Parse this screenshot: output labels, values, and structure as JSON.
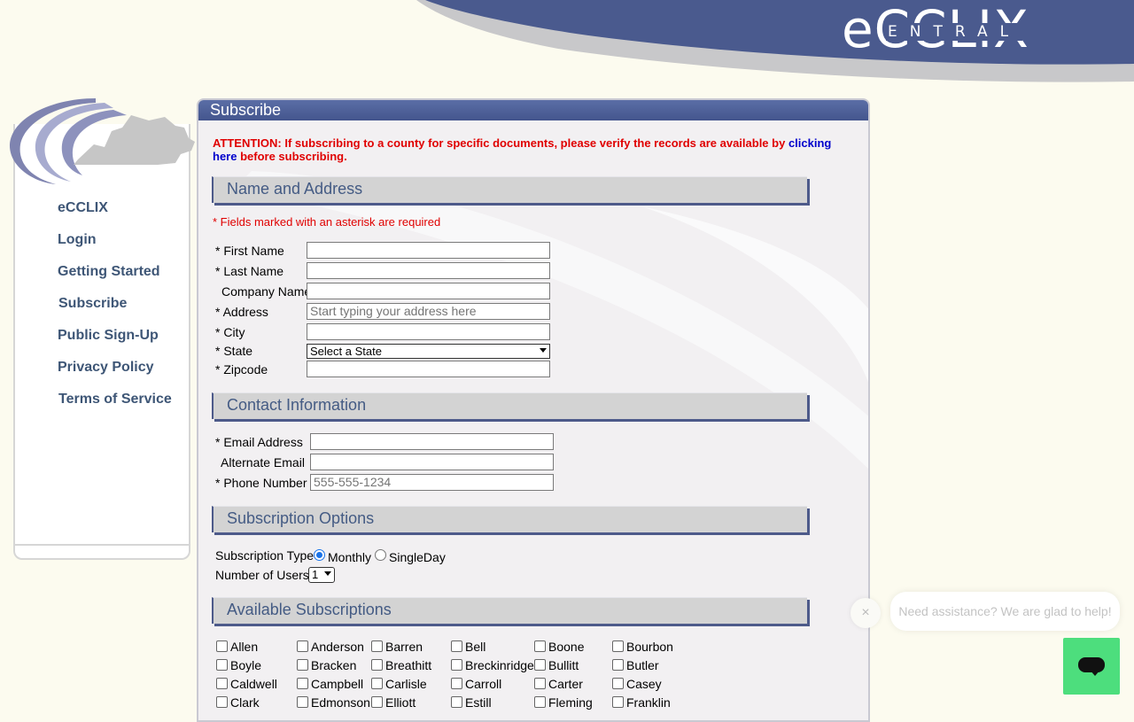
{
  "logo": {
    "big": "eCCLIX",
    "small": "ENTRAL"
  },
  "nav": [
    "eCCLIX",
    "Login",
    "Getting Started",
    "Subscribe",
    "Public Sign-Up",
    "Privacy Policy",
    "Terms of Service"
  ],
  "panel_title": "Subscribe",
  "attention": {
    "text": "ATTENTION: If subscribing to a county for specific documents, please verify the records are available by ",
    "link": "clicking here",
    "text_after": " before subscribing."
  },
  "sections": {
    "name_address": "Name and Address",
    "contact": "Contact Information",
    "options": "Subscription Options",
    "available": "Available Subscriptions"
  },
  "required_note": "* Fields marked with an asterisk are required",
  "name_form": {
    "first_name": "* First Name",
    "last_name": "* Last Name",
    "company": "Company Name",
    "address": "* Address",
    "address_placeholder": "Start typing your address here",
    "city": "* City",
    "state": "* State",
    "state_value": "Select a State",
    "zip": "* Zipcode"
  },
  "contact_form": {
    "email": "* Email Address",
    "alt_email": "Alternate Email",
    "phone": "* Phone Number",
    "phone_placeholder": "555-555-1234"
  },
  "options_form": {
    "type_label": "Subscription Type",
    "monthly": "Monthly",
    "single_day": "SingleDay",
    "users_label": "Number of Users",
    "users_value": "1"
  },
  "counties": [
    [
      "Allen",
      "Anderson",
      "Barren",
      "Bell",
      "Boone",
      "Bourbon"
    ],
    [
      "Boyle",
      "Bracken",
      "Breathitt",
      "Breckinridge",
      "Bullitt",
      "Butler"
    ],
    [
      "Caldwell",
      "Campbell",
      "Carlisle",
      "Carroll",
      "Carter",
      "Casey"
    ],
    [
      "Clark",
      "Edmonson",
      "Elliott",
      "Estill",
      "Fleming",
      "Franklin"
    ]
  ],
  "chat": {
    "close": "×",
    "prompt": "Need assistance? We are glad to help!"
  },
  "colors": {
    "header_blue": "#4a5a8e",
    "nav_text": "#3e5676",
    "alert_red": "#e00000",
    "chat_green": "#4dde7d"
  }
}
